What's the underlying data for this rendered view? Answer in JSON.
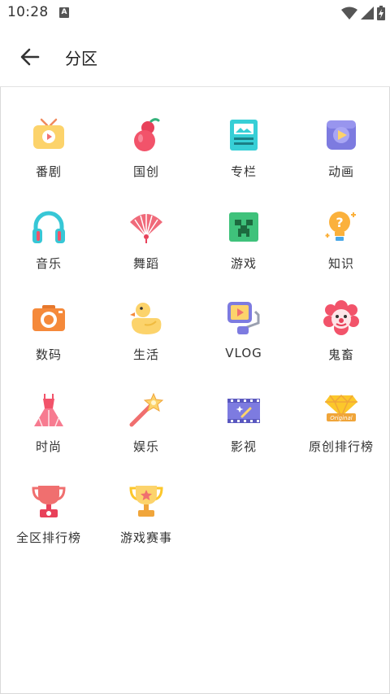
{
  "status_bar": {
    "time": "10:28",
    "notification_icon": "a-icon",
    "wifi_icon": "wifi-icon",
    "signal_icon": "signal-icon",
    "battery_icon": "battery-charging-icon"
  },
  "app_bar": {
    "back_icon": "arrow-left-icon",
    "title": "分区"
  },
  "categories": [
    {
      "label": "番剧",
      "icon": "tv-icon"
    },
    {
      "label": "国创",
      "icon": "gourd-icon"
    },
    {
      "label": "专栏",
      "icon": "article-icon"
    },
    {
      "label": "动画",
      "icon": "animation-play-icon"
    },
    {
      "label": "音乐",
      "icon": "headphones-icon"
    },
    {
      "label": "舞蹈",
      "icon": "fan-icon"
    },
    {
      "label": "游戏",
      "icon": "creeper-icon"
    },
    {
      "label": "知识",
      "icon": "lightbulb-question-icon"
    },
    {
      "label": "数码",
      "icon": "camera-icon"
    },
    {
      "label": "生活",
      "icon": "duck-icon"
    },
    {
      "label": "VLOG",
      "icon": "vlog-camera-icon"
    },
    {
      "label": "鬼畜",
      "icon": "clown-icon"
    },
    {
      "label": "时尚",
      "icon": "dress-icon"
    },
    {
      "label": "娱乐",
      "icon": "magic-wand-icon"
    },
    {
      "label": "影视",
      "icon": "film-icon"
    },
    {
      "label": "原创排行榜",
      "icon": "original-badge-icon"
    },
    {
      "label": "全区排行榜",
      "icon": "red-trophy-icon"
    },
    {
      "label": "游戏赛事",
      "icon": "gold-trophy-icon"
    }
  ]
}
